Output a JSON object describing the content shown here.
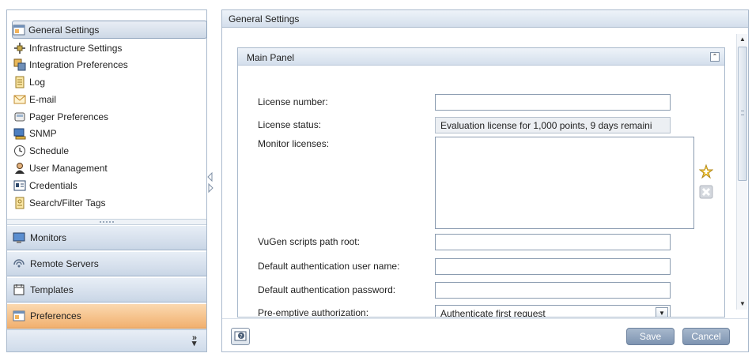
{
  "sidebar": {
    "tree": [
      {
        "label": "General Settings",
        "icon": "settings-window-icon",
        "selected": true
      },
      {
        "label": "Infrastructure Settings",
        "icon": "infrastructure-icon"
      },
      {
        "label": "Integration Preferences",
        "icon": "integration-icon"
      },
      {
        "label": "Log",
        "icon": "log-icon"
      },
      {
        "label": "E-mail",
        "icon": "email-icon"
      },
      {
        "label": "Pager Preferences",
        "icon": "pager-icon"
      },
      {
        "label": "SNMP",
        "icon": "snmp-icon"
      },
      {
        "label": "Schedule",
        "icon": "schedule-icon"
      },
      {
        "label": "User Management",
        "icon": "user-icon"
      },
      {
        "label": "Credentials",
        "icon": "credentials-icon"
      },
      {
        "label": "Search/Filter Tags",
        "icon": "tags-icon"
      }
    ],
    "sections": [
      {
        "label": "Monitors",
        "icon": "monitor-icon"
      },
      {
        "label": "Remote Servers",
        "icon": "remote-server-icon"
      },
      {
        "label": "Templates",
        "icon": "templates-icon"
      },
      {
        "label": "Preferences",
        "icon": "preferences-icon",
        "active": true
      }
    ],
    "more_glyph": "»"
  },
  "main": {
    "title": "General Settings",
    "panel": {
      "title": "Main Panel",
      "collapse_glyph": "⌃",
      "fields": {
        "license_number": {
          "label": "License number:",
          "value": ""
        },
        "license_status": {
          "label": "License status:",
          "value": "Evaluation license for 1,000 points, 9 days remaini"
        },
        "monitor_licenses": {
          "label": "Monitor licenses:"
        },
        "vugen_path": {
          "label": "VuGen scripts path root:",
          "value": ""
        },
        "auth_user": {
          "label": "Default authentication user name:",
          "value": ""
        },
        "auth_password": {
          "label": "Default authentication password:",
          "value": ""
        },
        "preemptive_auth": {
          "label": "Pre-emptive authorization:",
          "value": "Authenticate first request"
        }
      }
    },
    "footer": {
      "save_label": "Save",
      "cancel_label": "Cancel"
    }
  },
  "colors": {
    "accent_selected": "#f1b06f",
    "header_gradient": "#d4dfec",
    "button": "#8ea2bd"
  }
}
